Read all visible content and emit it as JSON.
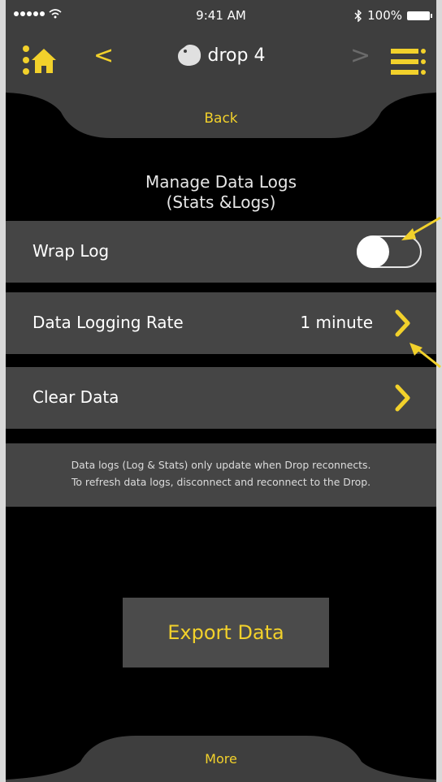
{
  "status_bar": {
    "time": "9:41 AM",
    "battery_text": "100%",
    "signal_icon": "signal-dots-icon",
    "wifi_icon": "wifi-icon",
    "bluetooth_icon": "bluetooth-icon"
  },
  "nav": {
    "title": "drop 4",
    "prev_glyph": "<",
    "next_glyph": ">",
    "home_icon": "home-icon",
    "menu_icon": "menu-icon"
  },
  "back": {
    "label": "Back"
  },
  "section": {
    "title_line1": "Manage Data Logs",
    "title_line2": "(Stats &Logs)"
  },
  "settings": {
    "wrap_log": {
      "label": "Wrap Log",
      "enabled": false
    },
    "logging_rate": {
      "label": "Data Logging Rate",
      "value": "1 minute"
    },
    "clear_data": {
      "label": "Clear Data"
    }
  },
  "info": {
    "line1": "Data logs (Log & Stats) only update when Drop reconnects.",
    "line2": "To refresh data logs, disconnect and reconnect to the Drop."
  },
  "export": {
    "label": "Export Data"
  },
  "more": {
    "label": "More"
  },
  "colors": {
    "accent": "#f2d12b",
    "bar": "#3e3e3e",
    "row": "#454545",
    "background": "#000000"
  }
}
